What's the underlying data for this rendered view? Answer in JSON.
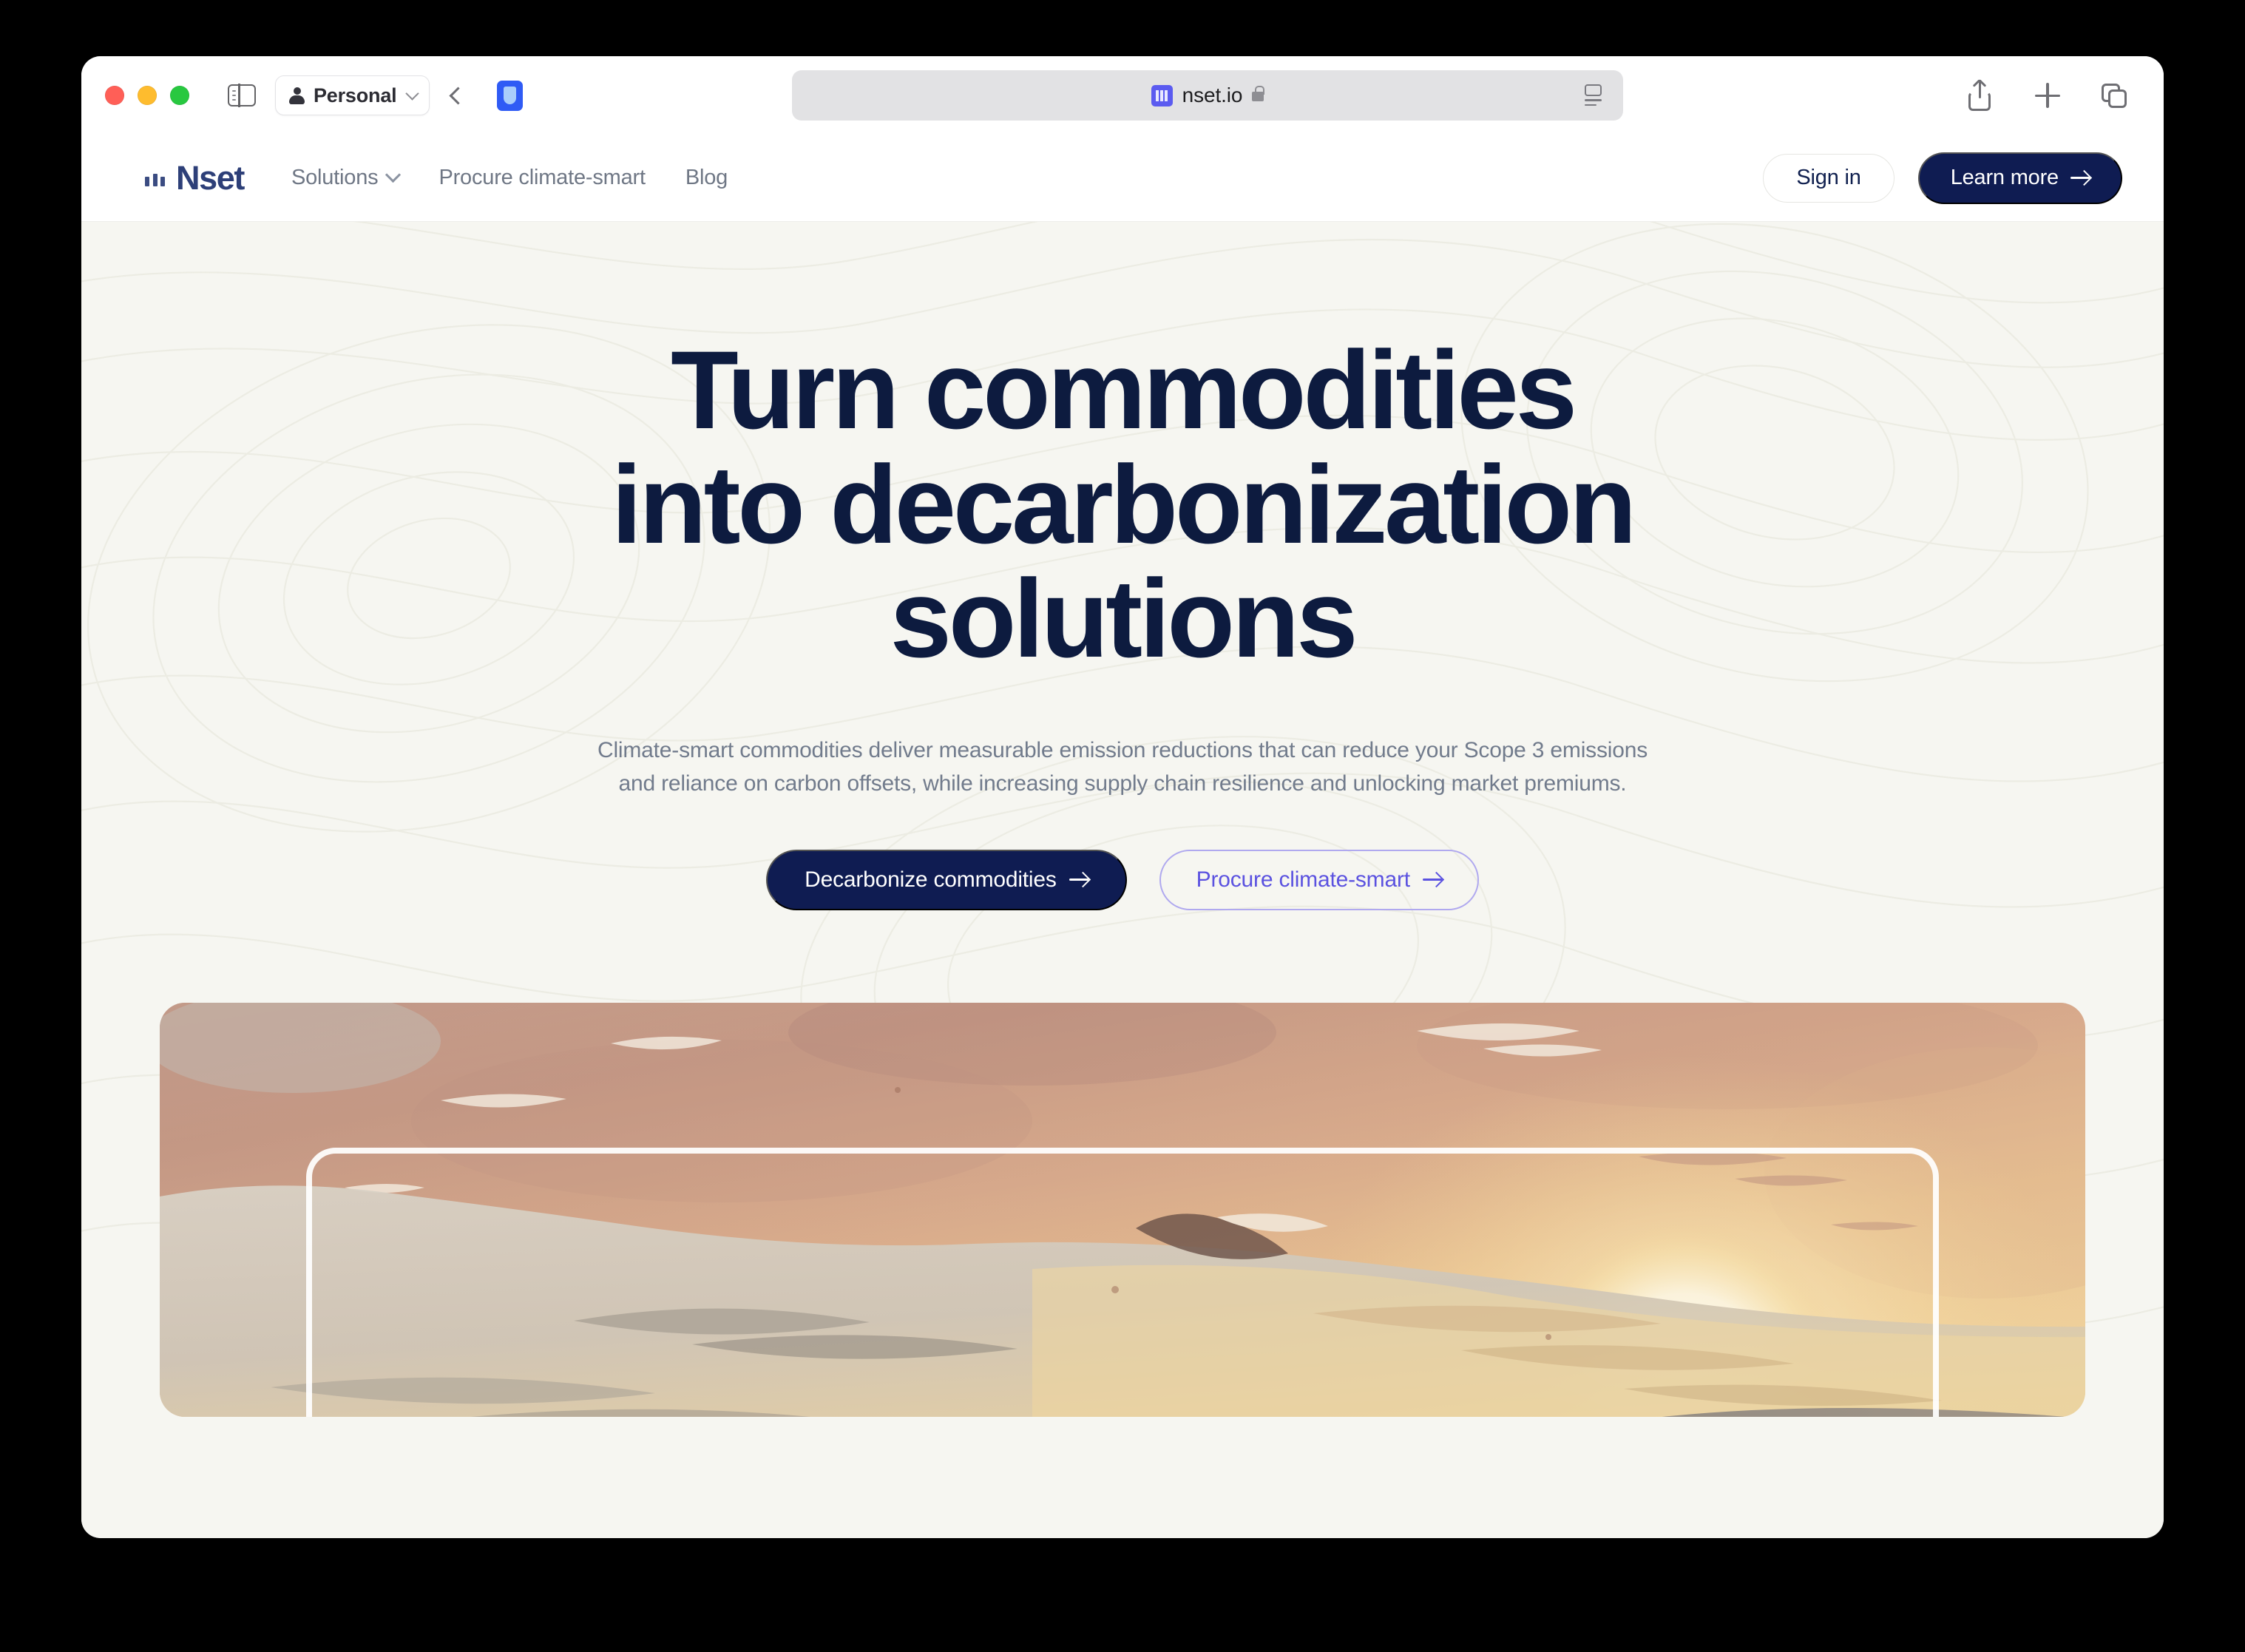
{
  "browser": {
    "profile": {
      "label": "Personal",
      "icon": "person-icon",
      "chevron": "chevron-down-icon"
    },
    "address": {
      "url": "nset.io",
      "favicon": "nset-favicon",
      "lock": "lock-icon",
      "reader": "reader-view-icon"
    },
    "back": "back-chevron-icon",
    "sidebar_toggle": "sidebar-toggle-icon",
    "extension": "shield-extension-icon",
    "actions": [
      "share-icon",
      "new-tab-icon",
      "tab-overview-icon"
    ],
    "traffic_lights": {
      "close": "#ff5f57",
      "minimize": "#febc2e",
      "zoom": "#28c840"
    }
  },
  "site": {
    "brand": {
      "name": "Nset",
      "mark": "three-bars-logo-mark"
    },
    "nav": [
      {
        "label": "Solutions",
        "has_dropdown": true
      },
      {
        "label": "Procure climate-smart",
        "has_dropdown": false
      },
      {
        "label": "Blog",
        "has_dropdown": false
      }
    ],
    "actions": {
      "sign_in": "Sign in",
      "learn_more": "Learn more"
    }
  },
  "hero": {
    "title_line1": "Turn commodities",
    "title_line2": "into decarbonization",
    "title_line3": "solutions",
    "subtitle_line1": "Climate-smart commodities deliver measurable emission reductions that can reduce your Scope 3 emissions",
    "subtitle_line2": "and reliance on carbon offsets, while increasing supply chain resilience and unlocking market premiums.",
    "cta_primary": "Decarbonize commodities",
    "cta_secondary": "Procure climate-smart",
    "artwork_alt": "watercolor-sunset-landscape"
  },
  "colors": {
    "page_background": "#f6f6f1",
    "navy": "#0f1c52",
    "heading_navy": "#0d1b3f",
    "brand_navy": "#2d3f78",
    "muted_text": "#717b8c",
    "nav_text": "#6f7785",
    "accent_indigo": "#5b52e0",
    "accent_indigo_border": "#b0a9ef"
  }
}
